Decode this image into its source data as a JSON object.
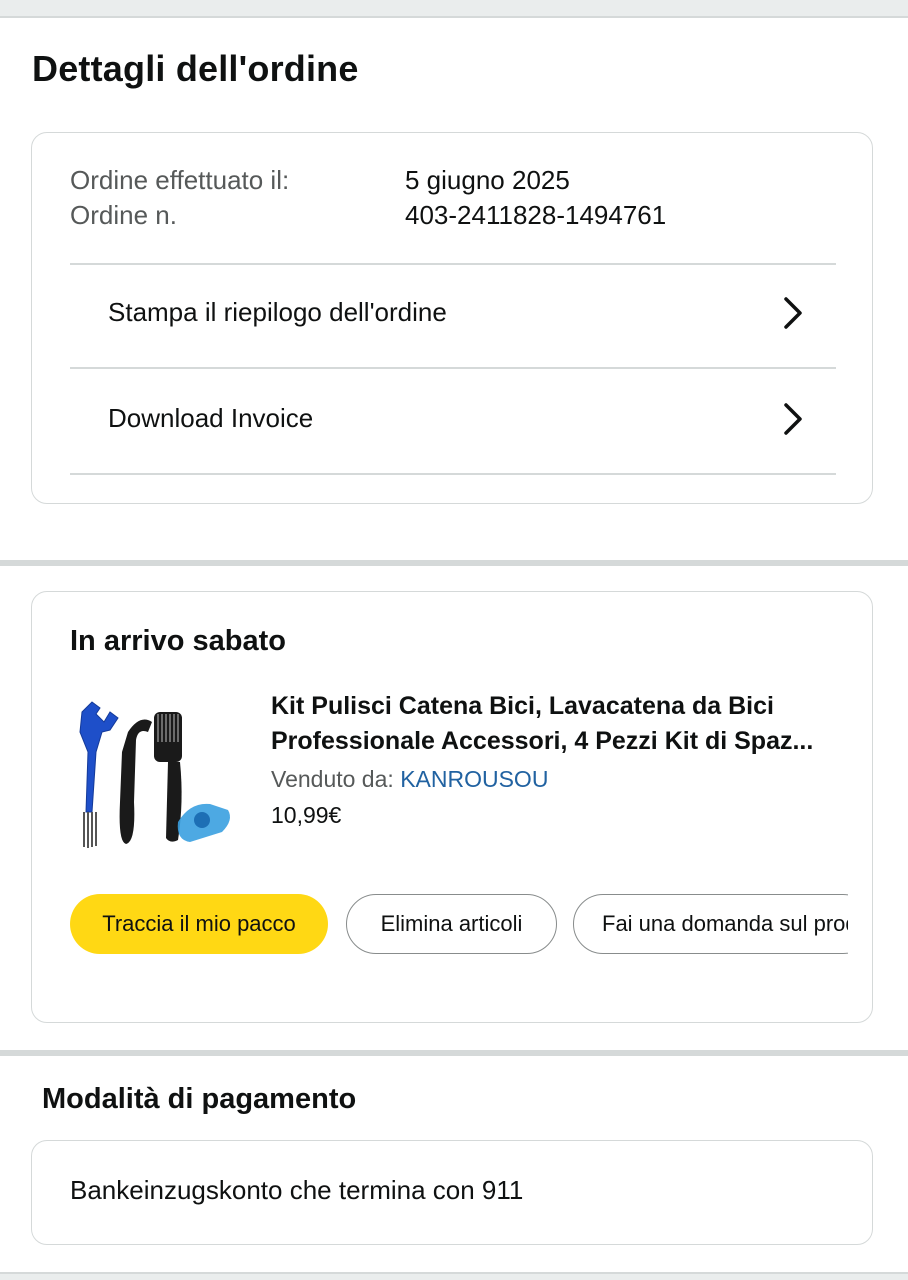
{
  "page": {
    "title": "Dettagli dell'ordine"
  },
  "order": {
    "date_label": "Ordine effettuato il:",
    "date_value": "5 giugno 2025",
    "number_label": "Ordine n.",
    "number_value": "403-2411828-1494761",
    "links": [
      {
        "label": "Stampa il riepilogo dell'ordine",
        "icon": "chevron-right-icon"
      },
      {
        "label": "Download Invoice",
        "icon": "chevron-right-icon"
      }
    ]
  },
  "shipment": {
    "heading": "In arrivo sabato",
    "product": {
      "title": "Kit Pulisci Catena Bici, Lavacatena da Bici Professionale Accessori, 4 Pezzi Kit di Spaz...",
      "sold_by_label": "Venduto da: ",
      "seller": "KANROUSOU",
      "price": "10,99€",
      "image": "bike-chain-cleaning-kit-image"
    },
    "buttons": {
      "track": "Traccia il mio pacco",
      "delete": "Elimina articoli",
      "ask": "Fai una domanda sul prodotto"
    }
  },
  "payment": {
    "heading": "Modalità di pagamento",
    "method": "Bankeinzugskonto che termina con 911"
  },
  "colors": {
    "primary_button": "#ffd814",
    "link": "#2162a1",
    "border": "#d5d9d9",
    "secondary_text": "#565959"
  }
}
